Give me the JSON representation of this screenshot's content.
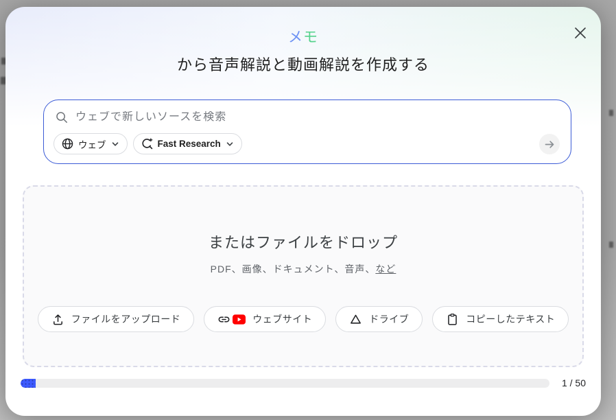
{
  "dialog": {
    "header": {
      "notebook_chars": [
        {
          "char": "メ",
          "color": "#6d92f4"
        },
        {
          "char": "モ",
          "color": "#55d28b"
        }
      ],
      "title": "から音声解説と動画解説を作成する"
    },
    "search": {
      "placeholder": "ウェブで新しいソースを検索",
      "source_filter_chip": {
        "label": "ウェブ",
        "icon": "globe-icon"
      },
      "research_mode_chip": {
        "label": "Fast Research",
        "icon": "research-sparkle-icon"
      }
    },
    "dropzone": {
      "heading": "またはファイルをドロップ",
      "subtext": "PDF、画像、ドキュメント、音声、",
      "subtext_link": "など",
      "buttons": [
        {
          "label": "ファイルをアップロード",
          "icon": "upload-icon"
        },
        {
          "label": "ウェブサイト",
          "icon": "link-icon youtube-icon"
        },
        {
          "label": "ドライブ",
          "icon": "drive-icon"
        },
        {
          "label": "コピーしたテキスト",
          "icon": "clipboard-icon"
        }
      ]
    },
    "progress": {
      "label": "1 / 50",
      "current": 1,
      "total": 50
    }
  },
  "colors": {
    "search_border": "#3b5bd6",
    "progress_fill": "#3d5afe",
    "title_blue": "#6d92f4",
    "title_green": "#55d28b",
    "youtube_red": "#ff0000"
  }
}
